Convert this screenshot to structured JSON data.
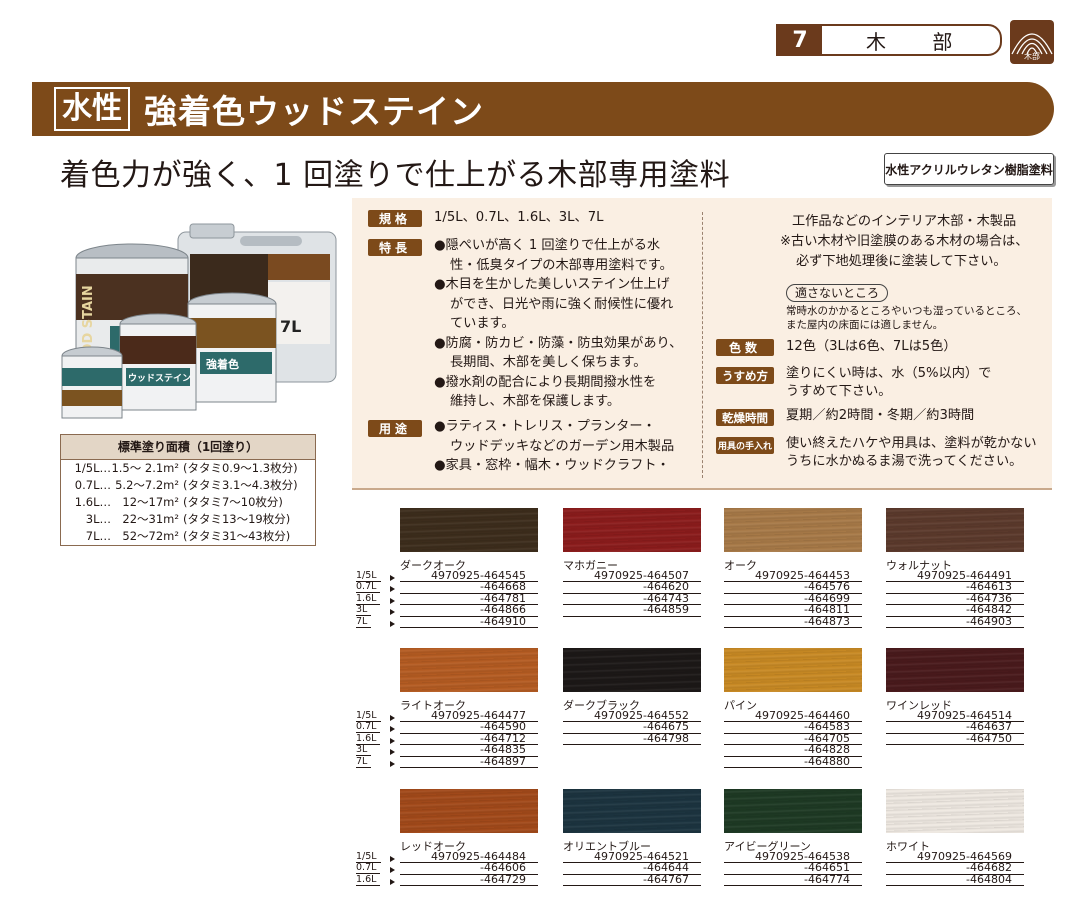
{
  "section": {
    "number": "7",
    "label": "木 部",
    "icon_label": "木部"
  },
  "title": {
    "badge": "水性",
    "name": "強着色ウッドステイン"
  },
  "subtitle": "着色力が強く、1 回塗りで仕上がる木部専用塗料",
  "resin_tag": "水性アクリルウレタン樹脂塗料",
  "cans": {
    "brand_side": "WOOD STAIN",
    "label_line1": "強着色",
    "label_line2": "ウッドステイン",
    "volume": "7L"
  },
  "coverage": {
    "heading": "標準塗り面積（1回塗り）",
    "rows": [
      {
        "size": "1/5L…",
        "area": "1.5～ 2.1m²",
        "tatami": "(タタミ0.9～1.3枚分)"
      },
      {
        "size": "0.7L…",
        "area": "5.2～7.2m²",
        "tatami": "(タタミ3.1～4.3枚分)"
      },
      {
        "size": "1.6L…",
        "area": "12～17m²",
        "tatami": "(タタミ7～10枚分)"
      },
      {
        "size": "3L…",
        "area": "22～31m²",
        "tatami": "(タタミ13～19枚分)"
      },
      {
        "size": "7L…",
        "area": "52～72m²",
        "tatami": "(タタミ31～43枚分)"
      }
    ]
  },
  "specs": {
    "spec_label": "規格",
    "spec_value": "1/5L、0.7L、1.6L、3L、7L",
    "feature_label": "特長",
    "features": [
      "●隠ぺいが高く 1 回塗りで仕上がる水",
      "性・低臭タイプの木部専用塗料です。",
      "●木目を生かした美しいステイン仕上げ",
      "ができ、日光や雨に強く耐候性に優れ",
      "ています。",
      "●防腐・防カビ・防藻・防虫効果があり、",
      "長期間、木部を美しく保ちます。",
      "●撥水剤の配合により長期間撥水性を",
      "維持し、木部を保護します。"
    ],
    "use_label": "用途",
    "uses": [
      "●ラティス・トレリス・プランター・",
      "ウッドデッキなどのガーデン用木製品",
      "●家具・窓枠・幅木・ウッドクラフト・"
    ],
    "use_continued": [
      "工作品などのインテリア木部・木製品",
      "※古い木材や旧塗膜のある木材の場合は、",
      "必ず下地処理後に塗装して下さい。"
    ],
    "unsuitable_label": "適さないところ",
    "unsuitable_text": [
      "常時水のかかるところやいつも湿っているところ、",
      "また屋内の床面には適しません。"
    ],
    "color_label": "色数",
    "color_value": "12色（3Lは6色、7Lは5色）",
    "thinner_label": "うすめ方",
    "thinner_value": [
      "塗りにくい時は、水（5%以内）で",
      "うすめて下さい。"
    ],
    "dry_label": "乾燥時間",
    "dry_value": "夏期／約2時間・冬期／約3時間",
    "care_label": "用具の手入れ",
    "care_value": [
      "使い終えたハケや用具は、塗料が乾かない",
      "うちに水かぬるま湯で洗ってください。"
    ]
  },
  "size_labels": [
    "1/5L",
    "0.7L",
    "1.6L",
    "3L",
    "7L"
  ],
  "colors": [
    {
      "name": "ダークオーク",
      "hex": "#3d2d1c",
      "codes": [
        "4970925-464545",
        "-464668",
        "-464781",
        "-464866",
        "-464910"
      ]
    },
    {
      "name": "マホガニー",
      "hex": "#8c1c1c",
      "codes": [
        "4970925-464507",
        "-464620",
        "-464743",
        "-464859"
      ]
    },
    {
      "name": "オーク",
      "hex": "#a87a48",
      "codes": [
        "4970925-464453",
        "-464576",
        "-464699",
        "-464811",
        "-464873"
      ]
    },
    {
      "name": "ウォルナット",
      "hex": "#5c3a2c",
      "codes": [
        "4970925-464491",
        "-464613",
        "-464736",
        "-464842",
        "-464903"
      ]
    },
    {
      "name": "ライトオーク",
      "hex": "#b55c22",
      "codes": [
        "4970925-464477",
        "-464590",
        "-464712",
        "-464835",
        "-464897"
      ]
    },
    {
      "name": "ダークブラック",
      "hex": "#1c1817",
      "codes": [
        "4970925-464552",
        "-464675",
        "-464798"
      ]
    },
    {
      "name": "パイン",
      "hex": "#c98a24",
      "codes": [
        "4970925-464460",
        "-464583",
        "-464705",
        "-464828",
        "-464880"
      ]
    },
    {
      "name": "ワインレッド",
      "hex": "#4a1a1c",
      "codes": [
        "4970925-464514",
        "-464637",
        "-464750"
      ]
    },
    {
      "name": "レッドオーク",
      "hex": "#a34a1a",
      "codes": [
        "4970925-464484",
        "-464606",
        "-464729"
      ]
    },
    {
      "name": "オリエントブルー",
      "hex": "#1c3440",
      "codes": [
        "4970925-464521",
        "-464644",
        "-464767"
      ]
    },
    {
      "name": "アイビーグリーン",
      "hex": "#1e3a24",
      "codes": [
        "4970925-464538",
        "-464651",
        "-464774"
      ]
    },
    {
      "name": "ホワイト",
      "hex": "#efe9e2",
      "codes": [
        "4970925-464569",
        "-464682",
        "-464804"
      ]
    }
  ]
}
